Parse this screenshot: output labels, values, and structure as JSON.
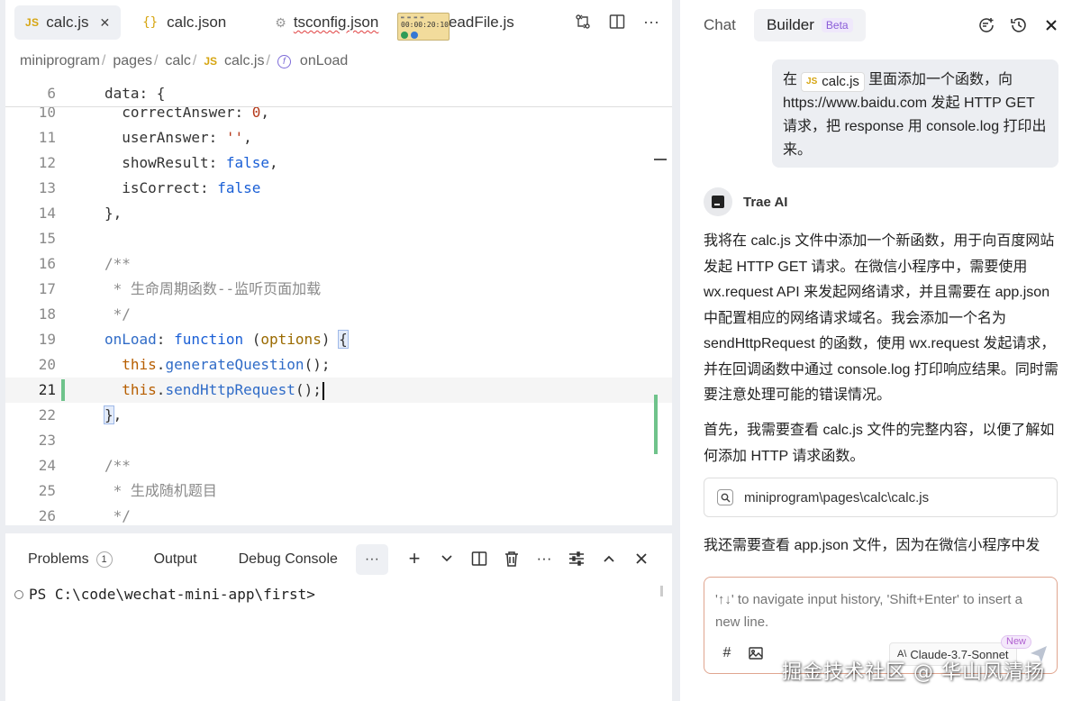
{
  "editor": {
    "tabs": [
      {
        "badge": "JS",
        "label": "calc.js",
        "close": "✕"
      },
      {
        "badge": "{}",
        "label": "calc.json"
      },
      {
        "badge": "⚙",
        "label": "tsconfig.json"
      },
      {
        "label": "readFile.js"
      }
    ],
    "clock_overlay": {
      "line1": "00:00:20:10"
    },
    "breadcrumb": {
      "parts": [
        "miniprogram",
        "pages",
        "calc"
      ],
      "file_badge": "JS",
      "file": "calc.js",
      "symbol": "onLoad"
    },
    "code_lines": [
      {
        "n": "6",
        "raw": "data: {"
      },
      {
        "n": "10",
        "raw": "  correctAnswer: 0,"
      },
      {
        "n": "11",
        "raw": "  userAnswer: '',"
      },
      {
        "n": "12",
        "raw": "  showResult: false,"
      },
      {
        "n": "13",
        "raw": "  isCorrect: false"
      },
      {
        "n": "14",
        "raw": "},"
      },
      {
        "n": "15",
        "raw": ""
      },
      {
        "n": "16",
        "raw": "/**"
      },
      {
        "n": "17",
        "raw": " * 生命周期函数--监听页面加载"
      },
      {
        "n": "18",
        "raw": " */"
      },
      {
        "n": "19",
        "raw": "onLoad: function (options) {"
      },
      {
        "n": "20",
        "raw": "  this.generateQuestion();"
      },
      {
        "n": "21",
        "raw": "  this.sendHttpRequest();"
      },
      {
        "n": "22",
        "raw": "},"
      },
      {
        "n": "23",
        "raw": ""
      },
      {
        "n": "24",
        "raw": "/**"
      },
      {
        "n": "25",
        "raw": " * 生成随机题目"
      },
      {
        "n": "26",
        "raw": " */"
      }
    ]
  },
  "terminal": {
    "tabs": [
      {
        "label": "Problems",
        "count": "1"
      },
      {
        "label": "Output"
      },
      {
        "label": "Debug Console"
      }
    ],
    "more": "···",
    "prompt": "PS C:\\code\\wechat-mini-app\\first>"
  },
  "chat": {
    "tabs": {
      "chat": "Chat",
      "builder": "Builder",
      "beta": "Beta"
    },
    "user_message": {
      "before": "在",
      "chip_badge": "JS",
      "chip_label": "calc.js",
      "after": "里面添加一个函数，向 https://www.baidu.com 发起 HTTP GET 请求，把 response 用 console.log 打印出来。"
    },
    "ai_name": "Trae AI",
    "ai_para1": "我将在 calc.js 文件中添加一个新函数，用于向百度网站发起 HTTP GET 请求。在微信小程序中，需要使用 wx.request API 来发起网络请求，并且需要在 app.json 中配置相应的网络请求域名。我会添加一个名为 sendHttpRequest 的函数，使用 wx.request 发起请求，并在回调函数中通过 console.log 打印响应结果。同时需要注意处理可能的错误情况。",
    "ai_para2": "首先，我需要查看 calc.js 文件的完整内容，以便了解如何添加 HTTP 请求函数。",
    "file_ref": "miniprogram\\pages\\calc\\calc.js",
    "ai_para3": "我还需要查看 app.json 文件，因为在微信小程序中发",
    "input": {
      "placeholder": "'↑↓' to navigate input history, 'Shift+Enter' to insert a new line.",
      "model": "Claude-3.7-Sonnet",
      "new_badge": "New"
    }
  },
  "watermark": "掘金技术社区 @ 华山风清扬"
}
